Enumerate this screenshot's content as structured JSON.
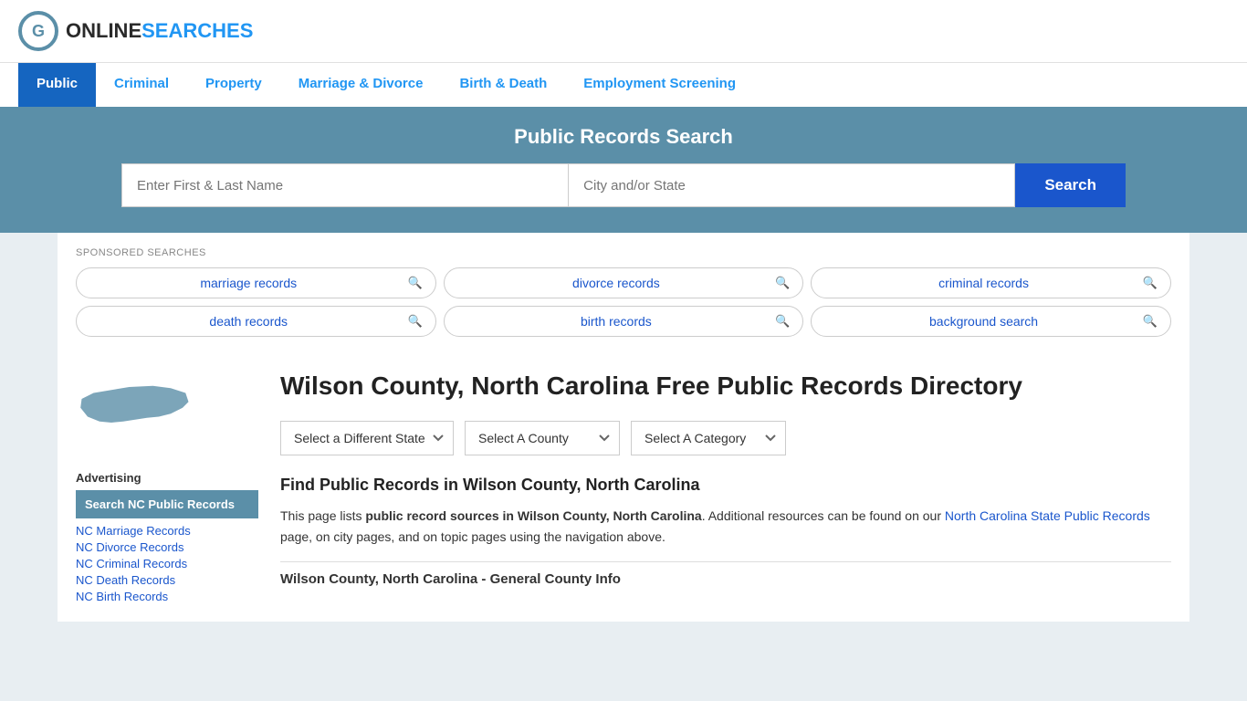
{
  "header": {
    "logo_online": "ONLINE",
    "logo_searches": "SEARCHES"
  },
  "nav": {
    "items": [
      {
        "label": "Public",
        "active": true
      },
      {
        "label": "Criminal",
        "active": false
      },
      {
        "label": "Property",
        "active": false
      },
      {
        "label": "Marriage & Divorce",
        "active": false
      },
      {
        "label": "Birth & Death",
        "active": false
      },
      {
        "label": "Employment Screening",
        "active": false
      }
    ]
  },
  "search_banner": {
    "title": "Public Records Search",
    "name_placeholder": "Enter First & Last Name",
    "location_placeholder": "City and/or State",
    "button_label": "Search"
  },
  "sponsored": {
    "label": "SPONSORED SEARCHES",
    "tags": [
      {
        "label": "marriage records"
      },
      {
        "label": "divorce records"
      },
      {
        "label": "criminal records"
      },
      {
        "label": "death records"
      },
      {
        "label": "birth records"
      },
      {
        "label": "background search"
      }
    ]
  },
  "sidebar": {
    "advertising_label": "Advertising",
    "ad_highlight": "Search NC Public Records",
    "links": [
      "NC Marriage Records",
      "NC Divorce Records",
      "NC Criminal Records",
      "NC Death Records",
      "NC Birth Records"
    ]
  },
  "main": {
    "page_title": "Wilson County, North Carolina Free Public Records Directory",
    "dropdowns": {
      "state": "Select a Different State",
      "county": "Select A County",
      "category": "Select A Category"
    },
    "find_title": "Find Public Records in Wilson County, North Carolina",
    "description_part1": "This page lists ",
    "description_bold": "public record sources in Wilson County, North Carolina",
    "description_part2": ". Additional resources can be found on our ",
    "description_link": "North Carolina State Public Records",
    "description_part3": " page, on city pages, and on topic pages using the navigation above.",
    "section_subtitle": "Wilson County, North Carolina - General County Info"
  }
}
